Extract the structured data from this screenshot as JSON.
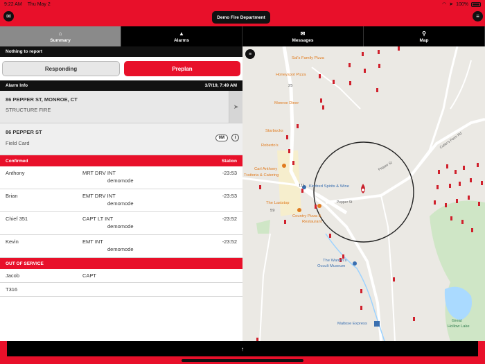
{
  "statusbar": {
    "time": "9:22 AM",
    "date": "Thu May 2",
    "battery": "100%"
  },
  "header": {
    "department": "Demo Fire Department"
  },
  "tabs": [
    {
      "label": "Summary",
      "icon": "home-icon"
    },
    {
      "label": "Alarms",
      "icon": "alert-triangle-icon"
    },
    {
      "label": "Messages",
      "icon": "envelope-icon"
    },
    {
      "label": "Map",
      "icon": "map-pin-icon"
    }
  ],
  "notice": "Nothing to report",
  "actions": {
    "responding": "Responding",
    "preplan": "Preplan"
  },
  "alarm_info": {
    "title": "Alarm Info",
    "datetime": "3/7/19, 7:49 AM",
    "address": "86 PEPPER ST, MONROE, CT",
    "type": "STRUCTURE FIRE"
  },
  "field_card": {
    "address": "86 PEPPER ST",
    "label": "Field Card",
    "badge": "0M"
  },
  "confirmed": {
    "title": "Confirmed",
    "station_label": "Station",
    "rows": [
      {
        "name": "Anthony",
        "role": "MRT DRV INT",
        "sub": "demomode",
        "time": "-23:53"
      },
      {
        "name": "Brian",
        "role": "EMT DRV INT",
        "sub": "demomode",
        "time": "-23:53"
      },
      {
        "name": "Chief 351",
        "role": "CAPT LT INT",
        "sub": "demomode",
        "time": "-23:52"
      },
      {
        "name": "Kevin",
        "role": "EMT INT",
        "sub": "demomode",
        "time": "-23:52"
      }
    ]
  },
  "out_of_service": {
    "title": "OUT OF SERVICE",
    "rows": [
      {
        "name": "Jacob",
        "role": "CAPT"
      },
      {
        "name": "T316",
        "role": ""
      }
    ]
  },
  "map": {
    "labels": {
      "sals": "Sal's Family Pizza",
      "honeyspot": "Honeyspot Pizza",
      "monroe_diner": "Monroe Diner",
      "starbucks": "Starbucks",
      "robertos": "Roberto's",
      "carl_anthony": "Carl Anthony",
      "trattoria": "Trattoria & Catering",
      "kindred": "Kindred Spirits & Wine",
      "laststop": "The Laststop",
      "country_pizza": "Country Pizza &",
      "restaurant": "Restaurant",
      "warrens": "The Warren's",
      "occult": "Occult Museum",
      "maltose": "Maltose Express",
      "great": "Great",
      "hollow_lake": "Hollow Lake",
      "pepper_st": "Pepper St",
      "pepper_st2": "Pepper St",
      "cutlers": "Cutler's Farm Rd",
      "r25": "25",
      "r59": "59",
      "r111": "111"
    }
  },
  "bottom": {
    "arrow": "↑"
  }
}
